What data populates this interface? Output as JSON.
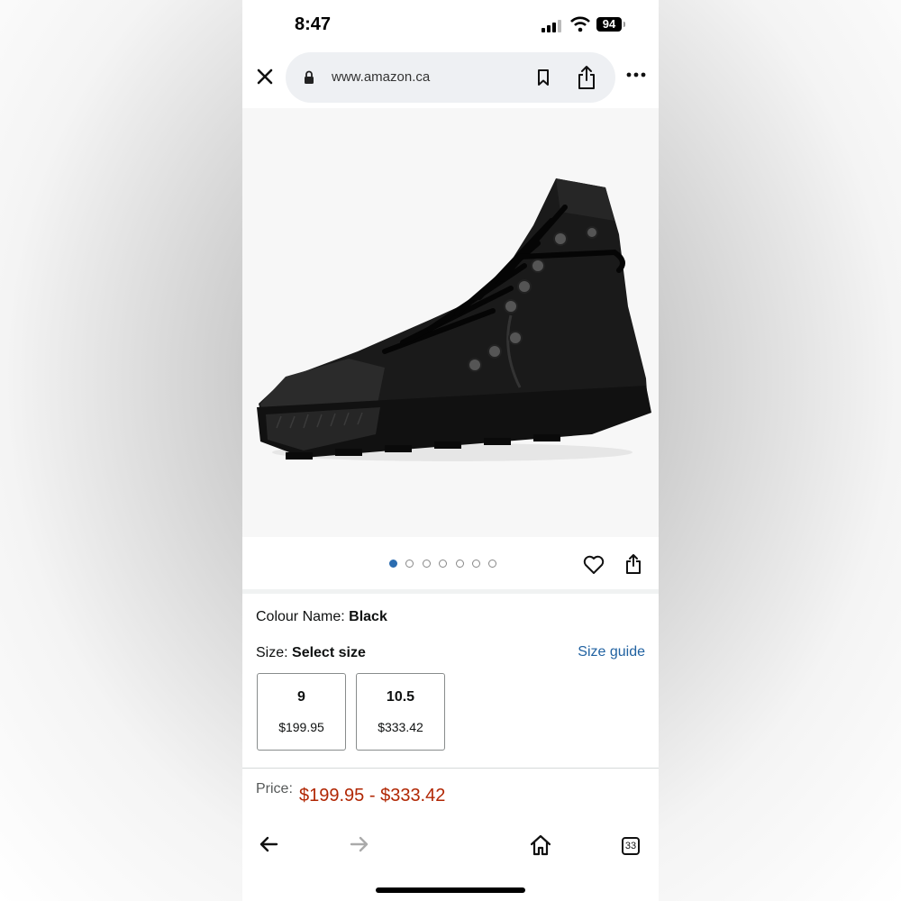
{
  "status_bar": {
    "time": "8:47",
    "battery": "94"
  },
  "browser": {
    "url": "www.amazon.ca"
  },
  "icons": {
    "close": "close-icon",
    "lock": "lock-icon",
    "bookmark": "bookmark-icon",
    "share": "share-icon",
    "more": "more-icon",
    "heart": "heart-icon",
    "back": "arrow-left-icon",
    "forward": "arrow-right-icon",
    "home": "home-icon"
  },
  "carousel": {
    "total": 7,
    "active_index": 0
  },
  "product": {
    "colour_label": "Colour Name: ",
    "colour_value": "Black",
    "size_label": "Size: ",
    "size_value": "Select size",
    "size_guide": "Size guide",
    "sizes": [
      {
        "size": "9",
        "price": "$199.95"
      },
      {
        "size": "10.5",
        "price": "$333.42"
      }
    ],
    "price_label": "Price:",
    "price_value": "$199.95 - $333.42"
  },
  "bottom_nav": {
    "tab_count": "33"
  },
  "colors": {
    "price": "#b12704",
    "link": "#2162a1",
    "active_dot": "#2b6cb0"
  }
}
